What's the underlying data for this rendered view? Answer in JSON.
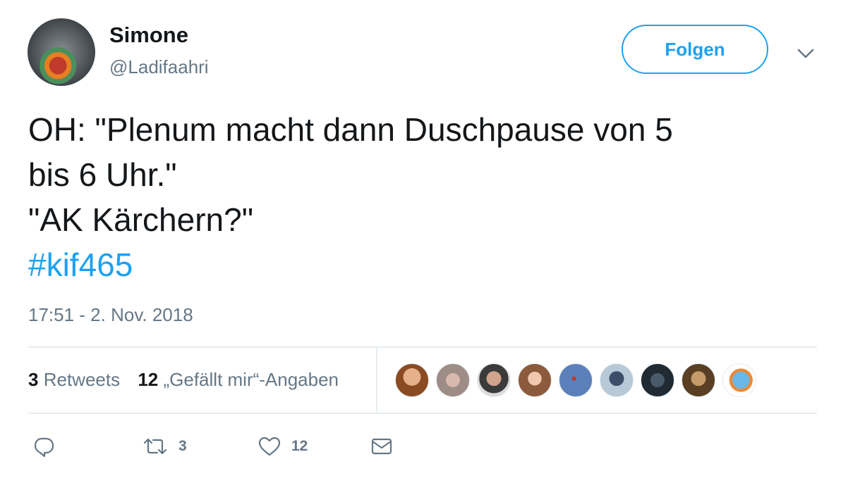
{
  "author": {
    "name": "Simone",
    "handle": "@Ladifaahri"
  },
  "follow_button": {
    "label": "Folgen"
  },
  "tweet": {
    "lines": [
      "OH: \"Plenum macht dann Duschpause von 5",
      "bis 6 Uhr.\"",
      "\"AK Kärchern?\""
    ],
    "hashtag": "#kif465",
    "timestamp": "17:51 - 2. Nov. 2018"
  },
  "stats": {
    "retweets_count": "3",
    "retweets_label": "Retweets",
    "likes_count": "12",
    "likes_label": "„Gefällt mir“-Angaben"
  },
  "likers": [
    {
      "icon": "liker-avatar-1"
    },
    {
      "icon": "liker-avatar-2"
    },
    {
      "icon": "liker-avatar-3"
    },
    {
      "icon": "liker-avatar-4"
    },
    {
      "icon": "liker-avatar-5"
    },
    {
      "icon": "liker-avatar-6"
    },
    {
      "icon": "liker-avatar-7"
    },
    {
      "icon": "liker-avatar-8"
    },
    {
      "icon": "liker-avatar-9"
    }
  ],
  "actions": {
    "reply": {
      "icon": "reply-icon"
    },
    "retweet": {
      "icon": "retweet-icon",
      "count": "3"
    },
    "like": {
      "icon": "heart-icon",
      "count": "12"
    },
    "dm": {
      "icon": "envelope-icon"
    }
  },
  "colors": {
    "accent": "#1da1f2",
    "text": "#14171a",
    "secondary_text": "#657786",
    "divider": "#e6ecf0"
  }
}
